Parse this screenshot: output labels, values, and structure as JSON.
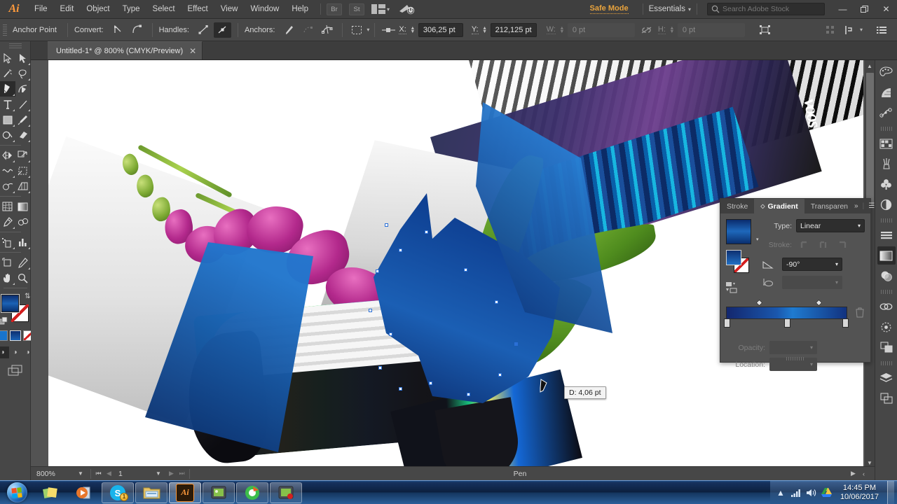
{
  "app": {
    "name": "Adobe Illustrator",
    "logo_text": "Ai"
  },
  "menubar": {
    "items": [
      "File",
      "Edit",
      "Object",
      "Type",
      "Select",
      "Effect",
      "View",
      "Window",
      "Help"
    ],
    "bridge_label": "Br",
    "stock_label": "St",
    "safe_mode": "Safe Mode",
    "workspace": "Essentials",
    "search_placeholder": "Search Adobe Stock",
    "search_value": "",
    "window_minimize": "—",
    "window_restore": "❐",
    "window_close": "✕"
  },
  "controlbar": {
    "title": "Anchor Point",
    "convert_label": "Convert:",
    "handles_label": "Handles:",
    "anchors_label": "Anchors:",
    "x_label": "X:",
    "x_value": "306,25 pt",
    "y_label": "Y:",
    "y_value": "212,125 pt",
    "w_label": "W:",
    "w_value": "0 pt",
    "h_label": "H:",
    "h_value": "0 pt"
  },
  "tabbar": {
    "document_title": "Untitled-1* @ 800% (CMYK/Preview)",
    "close_glyph": "✕"
  },
  "toolbar": {
    "tools": [
      "selection-tool",
      "direct-selection-tool",
      "magic-wand-tool",
      "lasso-tool",
      "pen-tool",
      "curvature-tool",
      "type-tool",
      "line-segment-tool",
      "rectangle-tool",
      "paintbrush-tool",
      "shaper-tool",
      "eraser-tool",
      "rotate-tool",
      "scale-tool",
      "width-tool",
      "free-transform-tool",
      "shape-builder-tool",
      "perspective-grid-tool",
      "mesh-tool",
      "gradient-tool",
      "eyedropper-tool",
      "blend-tool",
      "symbol-sprayer-tool",
      "column-graph-tool",
      "artboard-tool",
      "slice-tool",
      "hand-tool",
      "zoom-tool"
    ],
    "selected_tool": "pen-tool",
    "fill_label": "Fill",
    "stroke_label": "Stroke (None)"
  },
  "canvas": {
    "tooltip": "D: 4,06 pt",
    "artwork_note": "photo-collage with orchid and blue gradient vector shape",
    "brand_text": "Nike"
  },
  "gradient_panel": {
    "tabs": [
      {
        "label": "Stroke",
        "active": false
      },
      {
        "label": "Gradient",
        "active": true
      },
      {
        "label": "Transparen",
        "active": false
      }
    ],
    "overflow_glyph": "»",
    "menu_glyph": "☰",
    "type_label": "Type:",
    "type_value": "Linear",
    "stroke_label": "Stroke:",
    "angle_label": "angle-icon",
    "angle_value": "-90°",
    "aspect_label": "aspect-ratio-icon",
    "aspect_value": "",
    "opacity_label": "Opacity:",
    "opacity_value": "",
    "location_label": "Location:",
    "location_value": "",
    "stops": [
      {
        "position": 0,
        "color": "#13276e"
      },
      {
        "position": 50,
        "color": "#1f7bd0"
      },
      {
        "position": 100,
        "color": "#12327f"
      }
    ],
    "midpoints": [
      25,
      75
    ]
  },
  "dock": {
    "icons": [
      "color-palette-icon",
      "color-guide-icon",
      "path-point-icon",
      "swatches-icon",
      "brushes-icon",
      "symbols-icon",
      "appearance-icon",
      "align-icon",
      "gradient-icon",
      "transparency-icon",
      "links-icon",
      "transform-icon",
      "pathfinder-icon",
      "layers-icon",
      "artboards-icon"
    ],
    "active": "gradient-icon"
  },
  "statusbar": {
    "zoom": "800%",
    "page": "1",
    "tool_status": "Pen",
    "first_glyph": "⏮",
    "prev_glyph": "◀",
    "next_glyph": "▶",
    "last_glyph": "⏭",
    "play_glyph": "▶",
    "chevron_glyph": "‹"
  },
  "taskbar": {
    "start_label": "Start",
    "items": [
      {
        "name": "sticky-notes-app",
        "glyph": "◊",
        "pinned": true,
        "active": false,
        "badge": ""
      },
      {
        "name": "media-player-app",
        "glyph": "▶",
        "pinned": true,
        "active": false,
        "badge": ""
      },
      {
        "name": "skype-app",
        "glyph": "S",
        "pinned": false,
        "active": false,
        "badge": "1"
      },
      {
        "name": "file-explorer-app",
        "glyph": "🗀",
        "pinned": false,
        "active": false,
        "badge": ""
      },
      {
        "name": "illustrator-app",
        "glyph": "Ai",
        "pinned": false,
        "active": true,
        "badge": ""
      },
      {
        "name": "photo-viewer-app",
        "glyph": "▣",
        "pinned": false,
        "active": false,
        "badge": ""
      },
      {
        "name": "screen-recorder-app",
        "glyph": "◉",
        "pinned": false,
        "active": false,
        "badge": ""
      },
      {
        "name": "photo-editor-app",
        "glyph": "▣",
        "pinned": false,
        "active": false,
        "badge": ""
      }
    ],
    "tray": {
      "expand_glyph": "▲",
      "network_glyph": "◢",
      "volume_glyph": "🔊",
      "drive_glyph": "△",
      "time": "14:45 PM",
      "date": "10/06/2017"
    }
  },
  "colors": {
    "accent_orange": "#e8a33d",
    "panel_bg": "#535353",
    "chrome_bg": "#474747",
    "gradient_blue_dark": "#0b2c6d",
    "gradient_blue_light": "#1f7bd0",
    "orchid_magenta": "#b3298c",
    "leaf_green": "#4f8c1e"
  }
}
